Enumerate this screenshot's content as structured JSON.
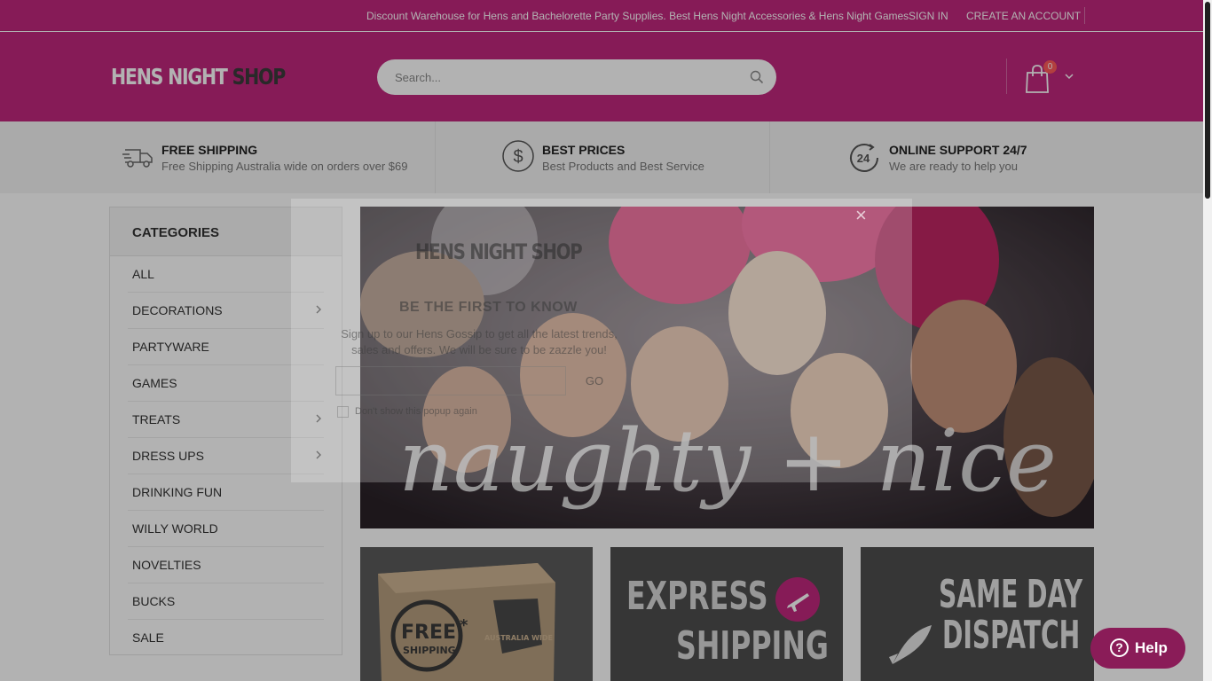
{
  "colors": {
    "brand": "#c1287d",
    "help": "#8a1c58",
    "badge": "#ff5b5b"
  },
  "topbar": {
    "promo": "Discount Warehouse for Hens and Bachelorette Party Supplies. Best Hens Night Accessories & Hens Night Games",
    "sign_in": "SIGN IN",
    "create_account": "CREATE AN ACCOUNT"
  },
  "header": {
    "logo_part1": "HENS NIGHT ",
    "logo_part2": "SHOP",
    "search_placeholder": "Search...",
    "search_icon": "search-icon",
    "cart_icon": "shopping-bag-icon",
    "cart_count": "0"
  },
  "features": [
    {
      "icon": "truck-icon",
      "title": "FREE SHIPPING",
      "subtitle": "Free Shipping Australia wide on orders over $69"
    },
    {
      "icon": "dollar-icon",
      "title": "BEST PRICES",
      "subtitle": "Best Products and Best Service"
    },
    {
      "icon": "support-24-icon",
      "title": "ONLINE SUPPORT 24/7",
      "subtitle": "We are ready to help you"
    }
  ],
  "categories": {
    "title": "CATEGORIES",
    "items": [
      {
        "label": "ALL",
        "has_sub": false
      },
      {
        "label": "DECORATIONS",
        "has_sub": true
      },
      {
        "label": "PARTYWARE",
        "has_sub": false
      },
      {
        "label": "GAMES",
        "has_sub": false
      },
      {
        "label": "TREATS",
        "has_sub": true
      },
      {
        "label": "DRESS UPS",
        "has_sub": true
      },
      {
        "label": "DRINKING FUN",
        "has_sub": false
      },
      {
        "label": "WILLY WORLD",
        "has_sub": false
      },
      {
        "label": "NOVELTIES",
        "has_sub": false
      },
      {
        "label": "BUCKS",
        "has_sub": false
      },
      {
        "label": "SALE",
        "has_sub": false
      }
    ]
  },
  "hero": {
    "text": "naughty + nice"
  },
  "banners": {
    "free_shipping_line1": "FREE",
    "free_shipping_line2": "SHIPPING",
    "free_shipping_asterisk": "*",
    "australia_wide": "AUSTRALIA WIDE",
    "express_line1": "EXPRESS",
    "express_line2": "SHIPPING",
    "same_day_line1": "SAME DAY",
    "same_day_line2": "DISPATCH"
  },
  "popup": {
    "logo": "HENS NIGHT SHOP",
    "title": "BE THE FIRST TO KNOW",
    "text": "Sign up to our Hens Gossip to get all the latest trends, sales and offers. We will be sure to be zazzle you!",
    "button": "GO",
    "checkbox_label": "Don't show this popup again",
    "close": "×"
  },
  "help": {
    "label": "Help",
    "icon_glyph": "?"
  }
}
